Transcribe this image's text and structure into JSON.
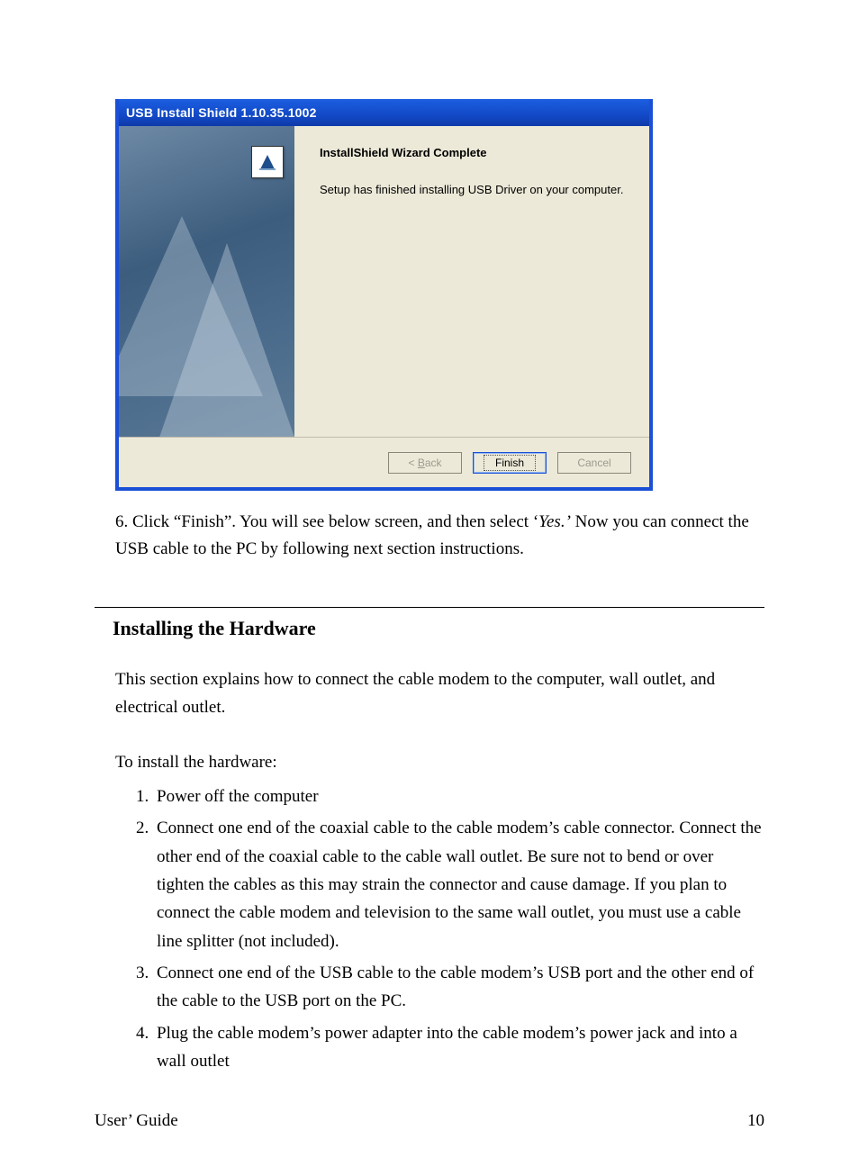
{
  "dialog": {
    "title": "USB Install Shield 1.10.35.1002",
    "logo_name": "installshield-logo-icon",
    "heading": "InstallShield Wizard Complete",
    "message": "Setup has finished installing USB Driver on your computer.",
    "buttons": {
      "back_prefix": "< ",
      "back_u": "B",
      "back_rest": "ack",
      "finish": "Finish",
      "cancel": "Cancel"
    }
  },
  "step6": {
    "prefix": "6. Click “Finish”. You will see below screen, and then select ‘",
    "yes": "Yes.’",
    "suffix": " Now you can connect the USB cable to the PC by following next section instructions."
  },
  "section_heading": "Installing the Hardware",
  "intro": "This section explains how to connect the cable modem to the computer, wall outlet, and electrical outlet.",
  "lead": "To install the hardware:",
  "steps": [
    "Power off the computer",
    "Connect one end of the coaxial cable to the cable modem’s cable connector.  Connect the other end of the coaxial cable to the cable wall outlet.  Be sure not to bend or over tighten the cables as this may strain the connector and cause damage.  If you plan to connect the cable modem and television to the same wall outlet, you must use a cable line splitter (not included).",
    "Connect one end of the USB cable to the cable modem’s USB port and the other end of the cable to the USB port on the PC.",
    "Plug the cable modem’s power adapter into the cable modem’s power jack and into a wall outlet"
  ],
  "footer": {
    "left": "User’ Guide",
    "right": "10"
  }
}
